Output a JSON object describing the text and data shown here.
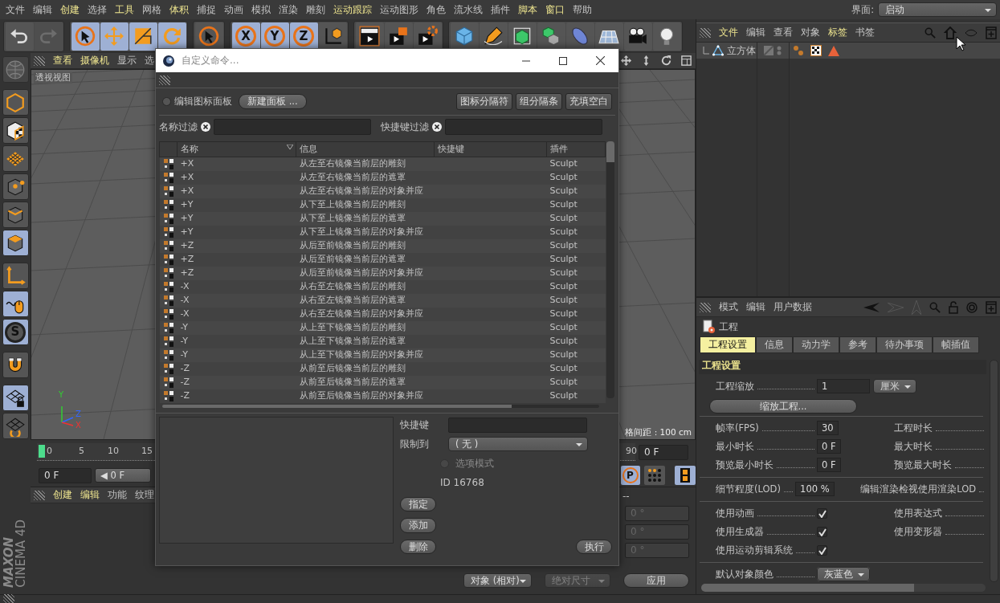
{
  "menu_bar": {
    "items": [
      {
        "label": "文件",
        "highlighted": false
      },
      {
        "label": "编辑",
        "highlighted": false
      },
      {
        "label": "创建",
        "highlighted": true
      },
      {
        "label": "选择",
        "highlighted": false
      },
      {
        "label": "工具",
        "highlighted": true
      },
      {
        "label": "网格",
        "highlighted": false
      },
      {
        "label": "体积",
        "highlighted": true
      },
      {
        "label": "捕捉",
        "highlighted": false
      },
      {
        "label": "动画",
        "highlighted": false
      },
      {
        "label": "模拟",
        "highlighted": false
      },
      {
        "label": "渲染",
        "highlighted": false
      },
      {
        "label": "雕刻",
        "highlighted": false
      },
      {
        "label": "运动跟踪",
        "highlighted": true
      },
      {
        "label": "运动图形",
        "highlighted": false
      },
      {
        "label": "角色",
        "highlighted": false
      },
      {
        "label": "流水线",
        "highlighted": false
      },
      {
        "label": "插件",
        "highlighted": false
      },
      {
        "label": "脚本",
        "highlighted": true
      },
      {
        "label": "窗口",
        "highlighted": true
      },
      {
        "label": "帮助",
        "highlighted": false
      }
    ],
    "interface_label": "界面:",
    "interface_value": "启动"
  },
  "toolbar": {
    "groups": [
      [
        {
          "kind": "icon",
          "active": false,
          "disabled": false
        },
        {
          "kind": "icon",
          "active": false,
          "disabled": true
        }
      ],
      [
        {
          "kind": "icon",
          "active": true,
          "disabled": false
        },
        {
          "kind": "icon",
          "active": true,
          "disabled": false
        },
        {
          "kind": "icon",
          "active": true,
          "disabled": false
        },
        {
          "kind": "icon",
          "active": true,
          "disabled": false
        }
      ],
      [
        {
          "kind": "icon",
          "active": false,
          "disabled": false
        }
      ],
      [
        {
          "kind": "letter",
          "label": "X",
          "active": true,
          "disabled": false
        },
        {
          "kind": "letter",
          "label": "Y",
          "active": true,
          "disabled": false
        },
        {
          "kind": "letter",
          "label": "Z",
          "active": true,
          "disabled": false
        },
        {
          "kind": "icon",
          "active": false,
          "disabled": false
        }
      ],
      [
        {
          "kind": "icon",
          "active": false,
          "disabled": false
        },
        {
          "kind": "icon",
          "active": false,
          "disabled": false
        },
        {
          "kind": "icon",
          "active": false,
          "disabled": false
        }
      ],
      [
        {
          "kind": "icon",
          "active": false,
          "disabled": false
        },
        {
          "kind": "icon",
          "active": false,
          "disabled": false
        },
        {
          "kind": "icon",
          "active": false,
          "disabled": false
        },
        {
          "kind": "icon",
          "active": false,
          "disabled": false
        },
        {
          "kind": "icon",
          "active": false,
          "disabled": false
        },
        {
          "kind": "icon",
          "active": false,
          "disabled": false
        },
        {
          "kind": "icon",
          "active": false,
          "disabled": false
        },
        {
          "kind": "icon",
          "active": false,
          "disabled": false
        }
      ]
    ]
  },
  "left_toolbar": [
    {
      "kind": "icon",
      "active": false,
      "disabled": true
    },
    {
      "kind": "icon",
      "active": false,
      "disabled": false
    },
    {
      "kind": "icon",
      "active": false,
      "disabled": false
    },
    {
      "kind": "icon",
      "active": false,
      "disabled": false
    },
    {
      "kind": "icon",
      "active": false,
      "disabled": false
    },
    {
      "kind": "icon",
      "active": false,
      "disabled": false
    },
    {
      "kind": "icon",
      "active": true,
      "disabled": false
    },
    {
      "kind": "icon",
      "active": false,
      "disabled": false
    },
    {
      "kind": "icon",
      "active": true,
      "disabled": false
    },
    {
      "kind": "letter",
      "label": "S",
      "active": true,
      "disabled": false
    },
    {
      "kind": "icon",
      "active": false,
      "disabled": false
    },
    {
      "kind": "icon",
      "active": true,
      "disabled": false
    },
    {
      "kind": "icon",
      "active": false,
      "disabled": false
    }
  ],
  "logo": {
    "brand": "MAXON",
    "product": "CINEMA 4D"
  },
  "viewport": {
    "menu": [
      {
        "label": "查看",
        "highlighted": true
      },
      {
        "label": "摄像机",
        "highlighted": true
      },
      {
        "label": "显示",
        "highlighted": false
      },
      {
        "label": "选",
        "highlighted": false
      }
    ],
    "view_name": "透视视图",
    "axis_labels": [
      "Y",
      "Z",
      "X"
    ],
    "grid_spacing": "格间距 : 100 cm"
  },
  "timeline": {
    "ticks": [
      "0",
      "5",
      "10",
      "15",
      "90"
    ],
    "end_field": "0 F",
    "start_field": "0 F",
    "slider_text": "◀ 0 F",
    "record_label": "P"
  },
  "materials": {
    "menu": [
      {
        "label": "创建",
        "highlighted": true
      },
      {
        "label": "编辑",
        "highlighted": true
      },
      {
        "label": "功能",
        "highlighted": false
      },
      {
        "label": "纹理",
        "highlighted": false
      }
    ]
  },
  "coordinates": {
    "header": "--",
    "fields": [
      "0 °",
      "0 °",
      "0 °"
    ],
    "mode": "对象 (相对)",
    "size_mode": "绝对尺寸",
    "apply_button": "应用"
  },
  "dialog": {
    "title": "自定义命令...",
    "edit_palette": {
      "label": "编辑图标面板",
      "checked": false
    },
    "new_palette_button": "新建面板 ...",
    "right_buttons": [
      "图标分隔符",
      "组分隔条",
      "充填空白"
    ],
    "name_filter_label": "名称过滤",
    "shortcut_filter_label": "快捷键过滤",
    "columns": [
      "名称",
      "信息",
      "快捷键",
      "插件"
    ],
    "rows": [
      {
        "name": "+X",
        "info": "从左至右镜像当前层的雕刻",
        "plugin": "Sculpt"
      },
      {
        "name": "+X",
        "info": "从左至右镜像当前层的遮罩",
        "plugin": "Sculpt"
      },
      {
        "name": "+X",
        "info": "从左至右镜像当前层的对象并应",
        "plugin": "Sculpt"
      },
      {
        "name": "+Y",
        "info": "从下至上镜像当前层的雕刻",
        "plugin": "Sculpt"
      },
      {
        "name": "+Y",
        "info": "从下至上镜像当前层的遮罩",
        "plugin": "Sculpt"
      },
      {
        "name": "+Y",
        "info": "从下至上镜像当前层的对象并应",
        "plugin": "Sculpt"
      },
      {
        "name": "+Z",
        "info": "从后至前镜像当前层的雕刻",
        "plugin": "Sculpt"
      },
      {
        "name": "+Z",
        "info": "从后至前镜像当前层的遮罩",
        "plugin": "Sculpt"
      },
      {
        "name": "+Z",
        "info": "从后至前镜像当前层的对象并应",
        "plugin": "Sculpt"
      },
      {
        "name": "-X",
        "info": "从右至左镜像当前层的雕刻",
        "plugin": "Sculpt"
      },
      {
        "name": "-X",
        "info": "从右至左镜像当前层的遮罩",
        "plugin": "Sculpt"
      },
      {
        "name": "-X",
        "info": "从右至左镜像当前层的对象并应",
        "plugin": "Sculpt"
      },
      {
        "name": "-Y",
        "info": "从上至下镜像当前层的雕刻",
        "plugin": "Sculpt"
      },
      {
        "name": "-Y",
        "info": "从上至下镜像当前层的遮罩",
        "plugin": "Sculpt"
      },
      {
        "name": "-Y",
        "info": "从上至下镜像当前层的对象并应",
        "plugin": "Sculpt"
      },
      {
        "name": "-Z",
        "info": "从前至后镜像当前层的雕刻",
        "plugin": "Sculpt"
      },
      {
        "name": "-Z",
        "info": "从前至后镜像当前层的遮罩",
        "plugin": "Sculpt"
      },
      {
        "name": "-Z",
        "info": "从前至后镜像当前层的对象并应",
        "plugin": "Sculpt"
      }
    ],
    "shortcut_label": "快捷键",
    "restrict_label": "限制到",
    "restrict_value": "( 无 )",
    "option_mode": {
      "label": "选项模式",
      "checked": false,
      "disabled": true
    },
    "id_text": "ID 16768",
    "buttons": [
      "指定",
      "添加",
      "删除"
    ],
    "execute_button": "执行"
  },
  "object_manager": {
    "menu": [
      {
        "label": "文件",
        "highlighted": true
      },
      {
        "label": "编辑",
        "highlighted": false
      },
      {
        "label": "查看",
        "highlighted": false
      },
      {
        "label": "对象",
        "highlighted": false
      },
      {
        "label": "标签",
        "highlighted": true
      },
      {
        "label": "书签",
        "highlighted": false
      }
    ],
    "objects": [
      {
        "name": "立方体"
      }
    ]
  },
  "attributes": {
    "menu": [
      "模式",
      "编辑",
      "用户数据"
    ],
    "title": "工程",
    "tabs": [
      {
        "label": "工程设置",
        "selected": true
      },
      {
        "label": "信息",
        "selected": false
      },
      {
        "label": "动力学",
        "selected": false
      },
      {
        "label": "参考",
        "selected": false
      },
      {
        "label": "待办事项",
        "selected": false
      },
      {
        "label": "帧插值",
        "selected": false
      }
    ],
    "section": "工程设置",
    "scale": {
      "label": "工程缩放",
      "value": "1",
      "unit": "厘米",
      "button": "缩放工程..."
    },
    "groups": [
      [
        {
          "kind": "number",
          "label": "帧率(FPS)",
          "value": "30",
          "right_label": "工程时长"
        },
        {
          "kind": "number",
          "label": "最小时长",
          "value": "0 F",
          "right_label": "最大时长"
        },
        {
          "kind": "number",
          "label": "预览最小时长",
          "value": "0 F",
          "right_label": "预览最大时长"
        }
      ],
      [
        {
          "kind": "number",
          "label": "细节程度(LOD)",
          "value": "100 %",
          "right_label": "编辑渲染检视使用渲染LOD"
        }
      ],
      [
        {
          "kind": "check",
          "label": "使用动画",
          "checked": true,
          "right_label": "使用表达式"
        },
        {
          "kind": "check",
          "label": "使用生成器",
          "checked": true,
          "right_label": "使用变形器"
        },
        {
          "kind": "check",
          "label": "使用运动剪辑系统",
          "checked": true
        }
      ],
      [
        {
          "kind": "select",
          "label": "默认对象颜色",
          "value": "灰蓝色"
        }
      ]
    ]
  }
}
